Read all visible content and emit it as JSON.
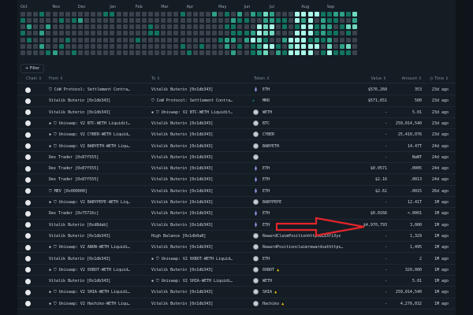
{
  "heatmap": {
    "months": [
      "Oct",
      "Nov",
      "Dec",
      "Jan",
      "Feb",
      "Mar",
      "Apr",
      "May",
      "Jun",
      "Jul",
      "Aug",
      "Sep"
    ],
    "levels": [
      "00010000000001100000000001000020102021320004444112213",
      "10000010120000000000000000000000021100221104240211002",
      "02002000000000000000100000000000110004340101441220133",
      "10020000000000000000110000000000011124330004441211010",
      "01000001000000000010000000000001220243100244412120000",
      "00020010000000000000000001001000201012441034444030230",
      "00001200100000000000000000100000020012302144440141110-"
    ],
    "colors": [
      "#3a434d",
      "#11745f",
      "#2fa184",
      "#6fd8bd",
      "#a8fbe6"
    ]
  },
  "filter_label": "+ Filter",
  "columns": {
    "chain": "Chain ⇕",
    "from": "From ⇕",
    "to": "To ⇕",
    "token": "Token ⇕",
    "value": "Value ⇕",
    "amount": "Amount ⇕",
    "time": "◷ Time ⇕"
  },
  "rows": [
    {
      "from": "⛉ CoW Protocol: Settlement Contra…",
      "to": "Vitalik Buterin [0x1db343]",
      "token": "ETH",
      "icon": "eth",
      "value": "$576,260",
      "amount": "353",
      "time": "23d ago"
    },
    {
      "from": "Vitalik Buterin [0x1db343]",
      "to": "⛉ CoW Protocol: Settlement Contra…",
      "token": "MKR",
      "icon": "mkr",
      "value": "$571,651",
      "amount": "500",
      "time": "23d ago"
    },
    {
      "from": "Vitalik Buterin [0x1db343]",
      "to": "▪ ⛉ Uniswap: V2 BTC-WETH Liquidit…",
      "token": "WETH",
      "icon": "coin",
      "value": "-",
      "amount": "5.01",
      "time": "23d ago"
    },
    {
      "from": "▪ ⛉ Uniswap: V2 BTC-WETH Liquidit…",
      "to": "Vitalik Buterin [0x1db343]",
      "token": "BTC",
      "icon": "coin",
      "value": "-",
      "amount": "259,014,540",
      "time": "23d ago"
    },
    {
      "from": "▪ ⛉ Uniswap: V2 CYBER-WETH Liquid…",
      "to": "Vitalik Buterin [0x1db343]",
      "token": "CYBER",
      "icon": "coin",
      "value": "-",
      "amount": "25,410,076",
      "time": "23d ago"
    },
    {
      "from": "▪ ⛉ Uniswap: V2 BABYETH-WETH Liqu…",
      "to": "Vitalik Buterin [0x1db343]",
      "token": "BABYETH",
      "icon": "coin",
      "value": "-",
      "amount": "14.47T",
      "time": "24d ago"
    },
    {
      "from": "Dex Trader [0x87f555]",
      "to": "Vitalik Buterin [0x1db343]",
      "token": "",
      "icon": "coin",
      "value": "-",
      "amount": "NaNT",
      "time": "24d ago"
    },
    {
      "from": "Dex Trader [0x87f555]",
      "to": "Vitalik Buterin [0x1db343]",
      "token": "ETH",
      "icon": "eth",
      "value": "$0.0571",
      "amount": ".0005",
      "time": "24d ago"
    },
    {
      "from": "Dex Trader [0x87f555]",
      "to": "Vitalik Buterin [0x1db343]",
      "token": "ETH",
      "icon": "eth",
      "value": "$2.16",
      "amount": ".0013",
      "time": "24d ago"
    },
    {
      "from": "⛉ MEV [0x000000]",
      "to": "Vitalik Buterin [0x1db343]",
      "token": "ETH",
      "icon": "eth",
      "value": "$2.61",
      "amount": ".0015",
      "time": "26d ago"
    },
    {
      "from": "▪ ⛉ Uniswap: V2 BABYPEPE-WETH Liq…",
      "to": "Vitalik Buterin [0x1db343]",
      "token": "BABYPEPE",
      "icon": "coin",
      "value": "-",
      "amount": "12.41T",
      "time": "1M ago"
    },
    {
      "from": "Dex Trader [0x75716c]",
      "to": "Vitalik Buterin [0x1db343]",
      "token": "ETH",
      "icon": "eth",
      "value": "$0.0166",
      "amount": "<.0001",
      "time": "1M ago"
    },
    {
      "from": "Vitalik Buterin [0xd8dab]",
      "to": "Vitalik Buterin [0x1db343]",
      "token": "ETH",
      "icon": "eth",
      "value": "$4,970,793",
      "amount": "3,000",
      "time": "1M ago"
    },
    {
      "from": "Vitalik Buterin [0x1db343]",
      "to": "High Balance [0x1db0a8]",
      "token": "RewardClaimPositionhttpsBLEXfiXyz",
      "icon": "coin",
      "value": "-",
      "amount": "1,329",
      "time": "1M ago"
    },
    {
      "from": "▪ ⛉ Uniswap: V2 ANON-WETH Liquidi…",
      "to": "Vitalik Buterin [0x1db343]",
      "token": "RewardPositionclaimrewardsathttps…",
      "icon": "coin",
      "value": "-",
      "amount": "1,495",
      "time": "1M ago"
    },
    {
      "from": "Vitalik Buterin [0x1db343]",
      "to": "▪ ⛉ Uniswap: V2 0XBOT-WETH Liquid…",
      "token": "ETH",
      "icon": "coin",
      "value": "-",
      "amount": "2",
      "time": "1M ago"
    },
    {
      "from": "▪ ⛉ Uniswap: V2 0XBOT-WETH Liquid…",
      "to": "Vitalik Buterin [0x1db343]",
      "token": "0XBOT",
      "icon": "coin",
      "warn": "▲",
      "value": "-",
      "amount": "320,000",
      "time": "1M ago"
    },
    {
      "from": "Vitalik Buterin [0x1db343]",
      "to": "▪ ⛉ Uniswap: V2 SHIA-WETH Liquidi…",
      "token": "WETH",
      "icon": "coin",
      "value": "-",
      "amount": "5.01",
      "time": "1M ago"
    },
    {
      "from": "▪ ⛉ Uniswap: V2 SHIA-WETH Liquidi…",
      "to": "Vitalik Buterin [0x1db343]",
      "token": "SHIA",
      "icon": "coin",
      "warn": "▲",
      "value": "-",
      "amount": "259,014,540",
      "time": "1M ago"
    },
    {
      "from": "▪ ⛉ Uniswap: V2 Hachiko-WETH Liqu…",
      "to": "Vitalik Buterin [0x1db343]",
      "token": "Hachiko",
      "icon": "coin",
      "warn": "▲",
      "value": "-",
      "amount": "4,276,032",
      "time": "1M ago"
    }
  ],
  "annotation_color": "#e0262b"
}
